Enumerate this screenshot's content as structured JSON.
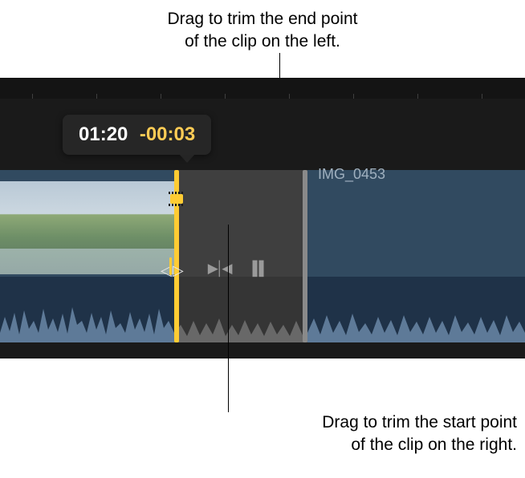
{
  "annotations": {
    "top_line1": "Drag to trim the end point",
    "top_line2": "of the clip on the left.",
    "bottom_line1": "Drag to trim the start point",
    "bottom_line2": "of the clip on the right."
  },
  "tooltip": {
    "time": "01:20",
    "delta": "-00:03"
  },
  "clip_right": {
    "title": "IMG_0453"
  },
  "icons": {
    "trim_handle": "trim-handle-icon",
    "left_arrow": "◁",
    "right_arrow": "▷",
    "skip": "▶▎◀",
    "pause": "▌▌"
  },
  "colors": {
    "accent": "#ffcc33",
    "clip_bg": "#314a60",
    "panel_bg": "#1a1a1a"
  }
}
